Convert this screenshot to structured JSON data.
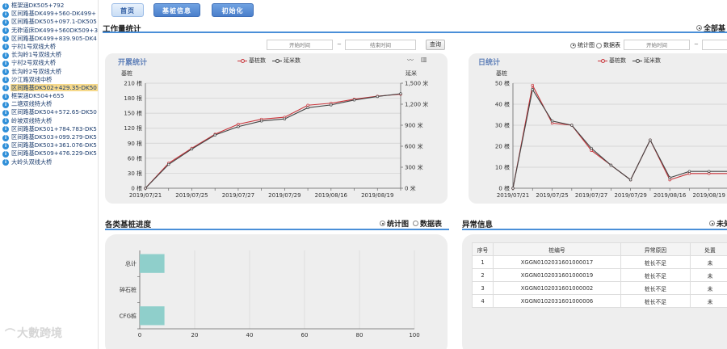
{
  "sidebar": {
    "items": [
      {
        "label": "框架涵DK505+792"
      },
      {
        "label": "区间路基DK499+560-DK499+"
      },
      {
        "label": "区间路基DK505+097.1-DK505"
      },
      {
        "label": "无砟道床DK499+560DK509+3"
      },
      {
        "label": "区间路基DK499+839.905-DK4"
      },
      {
        "label": "宁村1号双线大桥"
      },
      {
        "label": "长沟岭1号双线大桥"
      },
      {
        "label": "宁村2号双线大桥"
      },
      {
        "label": "长沟岭2号双线大桥"
      },
      {
        "label": "沙江路双线中桥"
      },
      {
        "label": "区间路基DK502+429.35-DK50"
      },
      {
        "label": "框架涵DK504+655"
      },
      {
        "label": "二塘双线特大桥"
      },
      {
        "label": "区间路基DK504+572.65-DK50"
      },
      {
        "label": "岭坡双线特大桥"
      },
      {
        "label": "区间路基DK501+784.783-DK5"
      },
      {
        "label": "区间路基DK503+099.279-DK5"
      },
      {
        "label": "区间路基DK503+361.076-DK5"
      },
      {
        "label": "区间路基DK509+476.229-DK5"
      },
      {
        "label": "大岭头双线大桥"
      }
    ],
    "selected_index": 10,
    "node_icon": "tree-node-icon",
    "watermark": "大數跨境"
  },
  "toolbar": {
    "home_label": "首页",
    "pile_info_label": "基桩信息",
    "init_label": "初始化"
  },
  "workload": {
    "title": "工作量统计",
    "all_label": "全部基",
    "start_placeholder": "开始时间",
    "end_placeholder": "结束时间",
    "range_sep": "~",
    "query_label": "查询",
    "chart_radio": "统计图",
    "table_radio": "数据表"
  },
  "cumulative_chart": {
    "title": "开累统计",
    "legend": [
      "基桩数",
      "延米数"
    ],
    "left_axis_name": "基桩",
    "right_axis_name": "延米"
  },
  "daily_chart": {
    "title": "日统计",
    "legend": [
      "基桩数",
      "延米数"
    ],
    "left_axis_name": "基桩"
  },
  "progress": {
    "title": "各类基桩进度",
    "chart_radio": "统计图",
    "table_radio": "数据表"
  },
  "abnormal": {
    "title": "异常信息",
    "filter_label": "未处"
  },
  "table": {
    "headers": [
      "序号",
      "桩编号",
      "异常原因",
      "处置"
    ],
    "rows": [
      [
        "1",
        "XGGN0102031601000017",
        "桩长不足",
        "未"
      ],
      [
        "2",
        "XGGN0102031601000019",
        "桩长不足",
        "未"
      ],
      [
        "3",
        "XGGN0102031601000002",
        "桩长不足",
        "未"
      ],
      [
        "4",
        "XGGN0102031601000006",
        "桩长不足",
        "未"
      ]
    ]
  },
  "colors": {
    "accent": "#4a8fd8",
    "series_pile": "#c9343a",
    "series_meter": "#444444",
    "bar_fill": "#8fcfcb"
  },
  "chart_data": [
    {
      "type": "line",
      "title": "开累统计",
      "x": [
        "2019/07/21",
        "2019/07/23",
        "2019/07/25",
        "2019/07/26",
        "2019/07/27",
        "2019/07/28",
        "2019/07/29",
        "2019/07/30",
        "2019/08/16",
        "2019/08/18",
        "2019/08/19",
        "2019/08/20"
      ],
      "x_tick_labels": [
        "2019/07/21",
        "2019/07/25",
        "2019/07/27",
        "2019/07/29",
        "2019/08/16",
        "2019/08/19"
      ],
      "series": [
        {
          "name": "基桩数",
          "axis": "left",
          "values": [
            0,
            50,
            80,
            108,
            128,
            138,
            142,
            166,
            170,
            178,
            184,
            188
          ]
        },
        {
          "name": "延米数",
          "axis": "right",
          "values": [
            0,
            340,
            560,
            760,
            880,
            960,
            990,
            1150,
            1190,
            1260,
            1310,
            1350
          ]
        }
      ],
      "y_left_ticks": [
        "0 根",
        "30 根",
        "60 根",
        "90 根",
        "120 根",
        "150 根",
        "180 根",
        "210 根"
      ],
      "y_right_ticks": [
        "0 米",
        "300 米",
        "600 米",
        "900 米",
        "1,200 米",
        "1,500 米"
      ],
      "ylim_left": [
        0,
        210
      ],
      "ylim_right": [
        0,
        1500
      ],
      "legend_position": "top-center",
      "grid": true
    },
    {
      "type": "line",
      "title": "日统计",
      "x": [
        "2019/07/21",
        "2019/07/23",
        "2019/07/25",
        "2019/07/26",
        "2019/07/27",
        "2019/07/28",
        "2019/07/29",
        "2019/07/30",
        "2019/08/16",
        "2019/08/18",
        "2019/08/19",
        "2019/08/20"
      ],
      "x_tick_labels": [
        "2019/07/21",
        "2019/07/25",
        "2019/07/27",
        "2019/07/29",
        "2019/08/16",
        "2019/08/19"
      ],
      "series": [
        {
          "name": "基桩数",
          "values": [
            0,
            49,
            31,
            30,
            18,
            11,
            4,
            23,
            4,
            7,
            7,
            7
          ]
        },
        {
          "name": "延米数",
          "values": [
            0,
            47,
            32,
            30,
            19,
            11,
            4,
            23,
            5,
            8,
            8,
            8
          ]
        }
      ],
      "y_left_ticks": [
        "0 根",
        "10 根",
        "20 根",
        "30 根",
        "40 根",
        "50 根"
      ],
      "ylim": [
        0,
        50
      ],
      "legend_position": "top-center",
      "grid": true
    },
    {
      "type": "bar",
      "title": "各类基桩进度",
      "orientation": "horizontal",
      "categories": [
        "总计",
        "碎石桩",
        "CFG桩"
      ],
      "values": [
        9,
        0,
        9
      ],
      "x_ticks": [
        "0",
        "20",
        "40",
        "60",
        "80",
        "100"
      ],
      "xlim": [
        0,
        100
      ],
      "grid": true
    }
  ]
}
